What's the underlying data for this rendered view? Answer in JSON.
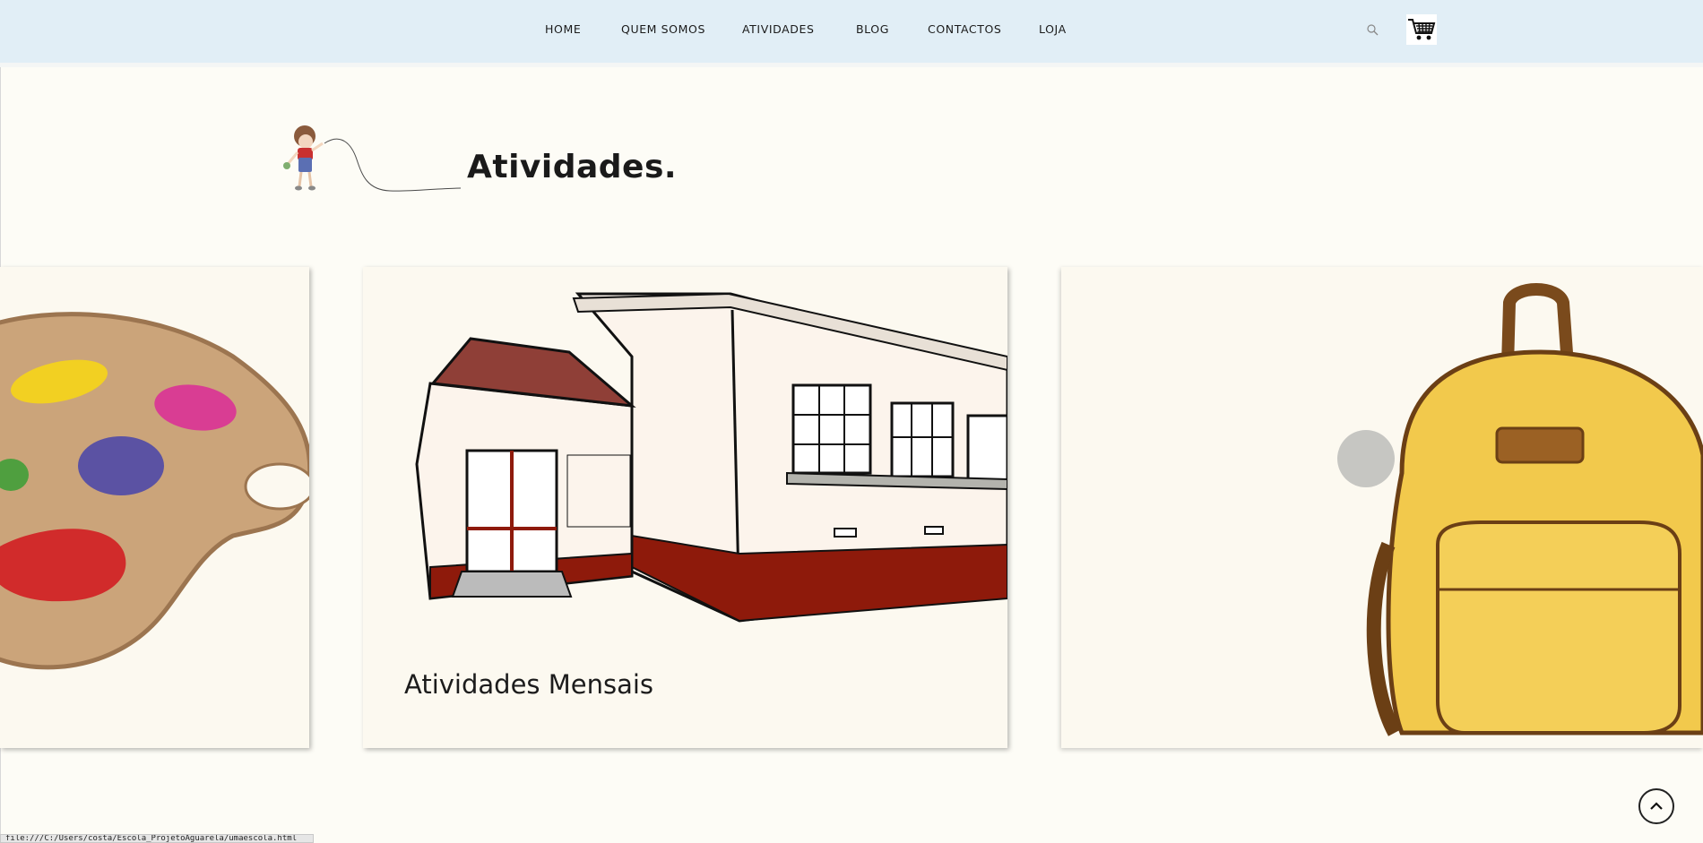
{
  "nav": {
    "items": [
      {
        "label": "HOME"
      },
      {
        "label": "QUEM SOMOS"
      },
      {
        "label": "ATIVIDADES"
      },
      {
        "label": "BLOG"
      },
      {
        "label": "CONTACTOS"
      },
      {
        "label": "LOJA"
      }
    ],
    "search_icon": "search-icon",
    "cart_icon": "shopping-cart-icon"
  },
  "page": {
    "title": "Atividades."
  },
  "carousel": {
    "slides": [
      {
        "image": "paint-palette"
      },
      {
        "image": "school-building",
        "caption": "Atividades Mensais"
      },
      {
        "image": "school-backpack"
      }
    ]
  },
  "back_to_top_icon": "chevron-up-icon",
  "status_bar": {
    "url": "file:///C:/Users/costa/Escola_ProjetoAguarela/umaescola.html"
  },
  "colors": {
    "header_bg": "#e1eef6",
    "page_bg": "#fdfcf6",
    "card_bg": "#fcf9f0",
    "school_base_red": "#8e1a0b",
    "backpack_yellow": "#f2c94c"
  }
}
